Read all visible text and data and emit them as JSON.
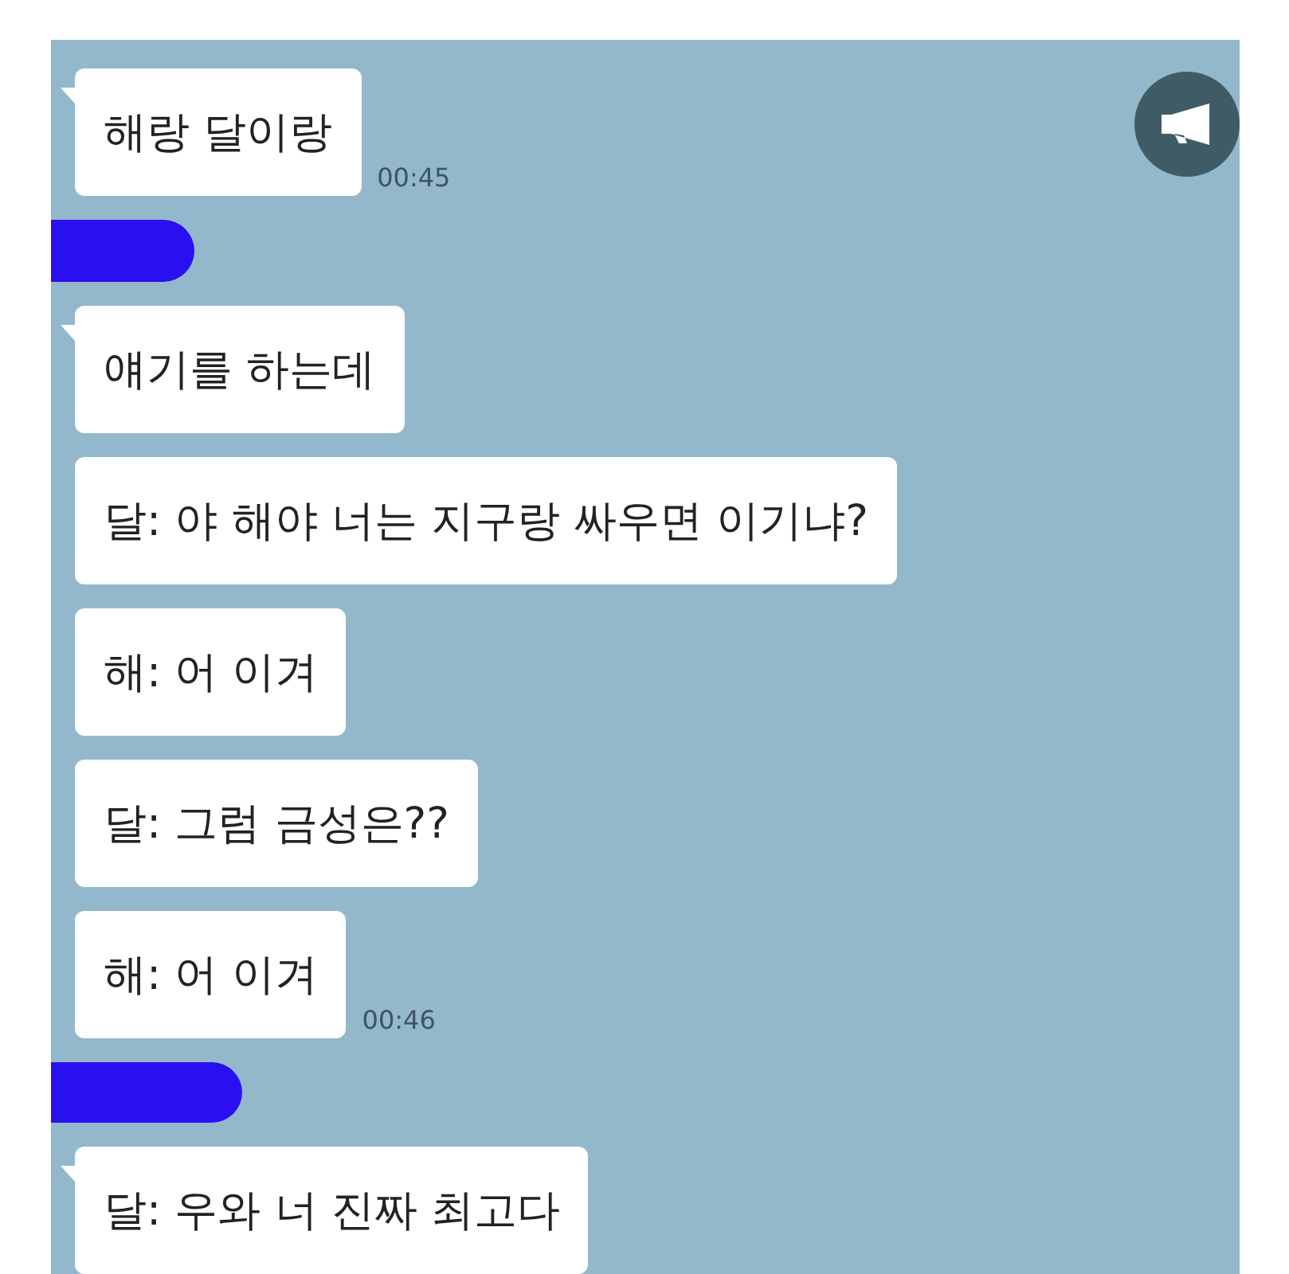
{
  "chat": {
    "messages": [
      {
        "kind": "bubble",
        "text": "해랑 달이랑",
        "time": "00:45",
        "tail": true
      },
      {
        "kind": "redaction"
      },
      {
        "kind": "bubble",
        "text": "얘기를 하는데",
        "tail": true
      },
      {
        "kind": "bubble",
        "text": "달: 야 해야 너는 지구랑 싸우면 이기냐?",
        "tail": false
      },
      {
        "kind": "bubble",
        "text": "해: 어 이겨",
        "tail": false
      },
      {
        "kind": "bubble",
        "text": "달: 그럼 금성은??",
        "tail": false
      },
      {
        "kind": "bubble",
        "text": "해: 어 이겨",
        "time": "00:46",
        "tail": false
      },
      {
        "kind": "redaction"
      },
      {
        "kind": "bubble",
        "text": "달: 우와 너 진짜 최고다",
        "tail": true
      }
    ]
  }
}
